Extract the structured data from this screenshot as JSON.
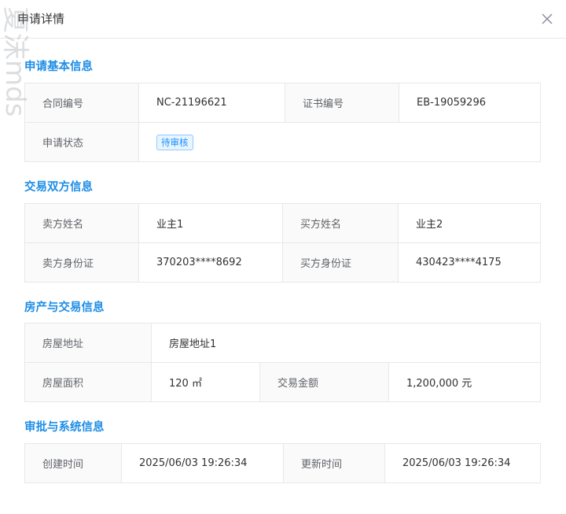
{
  "dialog": {
    "title": "申请详情"
  },
  "watermark": {
    "text": "夏沫mds"
  },
  "sections": {
    "basic": {
      "title": "申请基本信息",
      "contract_label": "合同编号",
      "contract_value": "NC-21196621",
      "cert_label": "证书编号",
      "cert_value": "EB-19059296",
      "status_label": "申请状态",
      "status_value": "待审核"
    },
    "parties": {
      "title": "交易双方信息",
      "seller_name_label": "卖方姓名",
      "seller_name_value": "业主1",
      "buyer_name_label": "买方姓名",
      "buyer_name_value": "业主2",
      "seller_id_label": "卖方身份证",
      "seller_id_value": "370203****8692",
      "buyer_id_label": "买方身份证",
      "buyer_id_value": "430423****4175"
    },
    "property": {
      "title": "房产与交易信息",
      "address_label": "房屋地址",
      "address_value": "房屋地址1",
      "area_label": "房屋面积",
      "area_value": "120 ㎡",
      "amount_label": "交易金额",
      "amount_value": "1,200,000 元"
    },
    "system": {
      "title": "审批与系统信息",
      "created_label": "创建时间",
      "created_value": "2025/06/03 19:26:34",
      "updated_label": "更新时间",
      "updated_value": "2025/06/03 19:26:34"
    }
  },
  "colors": {
    "accent": "#1f8ee6",
    "tag": "#1890ff"
  }
}
